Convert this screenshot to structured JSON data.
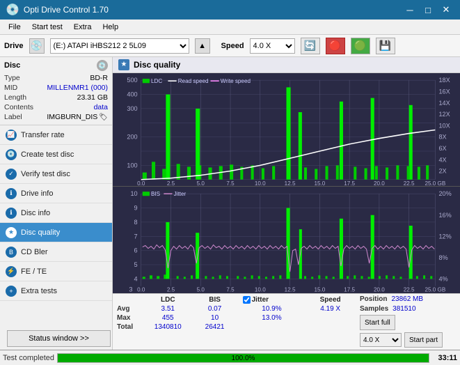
{
  "titleBar": {
    "title": "Opti Drive Control 1.70",
    "minimize": "─",
    "maximize": "□",
    "close": "✕"
  },
  "menuBar": {
    "items": [
      "File",
      "Start test",
      "Extra",
      "Help"
    ]
  },
  "driveBar": {
    "driveLabel": "Drive",
    "driveValue": "(E:)  ATAPI iHBS212  2 5L09",
    "speedLabel": "Speed",
    "speedValue": "4.0 X"
  },
  "disc": {
    "title": "Disc",
    "typeLabel": "Type",
    "typeValue": "BD-R",
    "midLabel": "MID",
    "midValue": "MILLENMR1 (000)",
    "lengthLabel": "Length",
    "lengthValue": "23.31 GB",
    "contentsLabel": "Contents",
    "contentsValue": "data",
    "labelLabel": "Label",
    "labelValue": "IMGBURN_DIS"
  },
  "nav": {
    "items": [
      {
        "label": "Transfer rate",
        "active": false
      },
      {
        "label": "Create test disc",
        "active": false
      },
      {
        "label": "Verify test disc",
        "active": false
      },
      {
        "label": "Drive info",
        "active": false
      },
      {
        "label": "Disc info",
        "active": false
      },
      {
        "label": "Disc quality",
        "active": true
      },
      {
        "label": "CD Bler",
        "active": false
      },
      {
        "label": "FE / TE",
        "active": false
      },
      {
        "label": "Extra tests",
        "active": false
      }
    ]
  },
  "statusBar": {
    "buttonLabel": "Status window >>",
    "progress": 100,
    "progressText": "100.0%",
    "time": "33:11"
  },
  "chart1": {
    "title": "Disc quality",
    "legend": {
      "ldc": "LDC",
      "readSpeed": "Read speed",
      "writeSpeed": "Write speed"
    },
    "yAxisMax": 500,
    "yAxisRight": [
      "18X",
      "16X",
      "14X",
      "12X",
      "10X",
      "8X",
      "6X",
      "4X",
      "2X"
    ],
    "xAxisLabels": [
      "0.0",
      "2.5",
      "5.0",
      "7.5",
      "10.0",
      "12.5",
      "15.0",
      "17.5",
      "20.0",
      "22.5",
      "25.0"
    ]
  },
  "chart2": {
    "legend": {
      "bis": "BIS",
      "jitter": "Jitter"
    },
    "yAxisMax": 10,
    "yAxisRight": [
      "20%",
      "16%",
      "12%",
      "8%",
      "4%"
    ],
    "xAxisLabels": [
      "0.0",
      "2.5",
      "5.0",
      "7.5",
      "10.0",
      "12.5",
      "15.0",
      "17.5",
      "20.0",
      "22.5",
      "25.0"
    ]
  },
  "bottomData": {
    "columns": [
      "LDC",
      "BIS",
      "",
      "Jitter",
      "Speed"
    ],
    "avgLabel": "Avg",
    "avgLDC": "3.51",
    "avgBIS": "0.07",
    "avgJitter": "10.9%",
    "avgSpeed": "4.19 X",
    "maxLabel": "Max",
    "maxLDC": "455",
    "maxBIS": "10",
    "maxJitter": "13.0%",
    "totalLabel": "Total",
    "totalLDC": "1340810",
    "totalBIS": "26421",
    "positionLabel": "Position",
    "positionValue": "23862 MB",
    "samplesLabel": "Samples",
    "samplesValue": "381510",
    "startFullLabel": "Start full",
    "startPartLabel": "Start part",
    "speedSelectValue": "4.0 X"
  }
}
